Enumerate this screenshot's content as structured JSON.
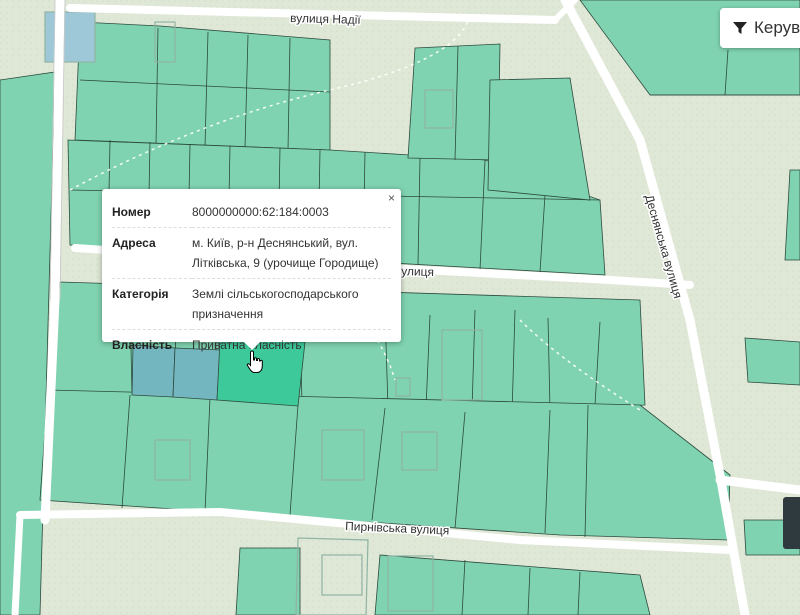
{
  "streets": {
    "nadii": "вулиця Надії",
    "litkivska_partial": "вулиця",
    "desnianska": "Деснянська вулиця",
    "pyrnivska": "Пирнівська вулиця"
  },
  "toolbar": {
    "manage_label": "Керув",
    "icon": "filter-icon"
  },
  "popup": {
    "close": "×",
    "rows": [
      {
        "key": "Номер",
        "value": "8000000000:62:184:0003"
      },
      {
        "key": "Адреса",
        "value": "м. Київ, р-н Деснянський, вул. Літківська, 9 (урочище Городище)"
      },
      {
        "key": "Категорія",
        "value": "Землі сільськогосподарського призначення"
      },
      {
        "key": "Власність",
        "value": "Приватна власність"
      }
    ]
  },
  "colors": {
    "parcel": "#7fd3b0",
    "parcel_border": "#2d3d35",
    "selected": "#3dc99a",
    "highlight": "#74b6bf",
    "road": "#ffffff",
    "background": "#dfe8d6"
  }
}
